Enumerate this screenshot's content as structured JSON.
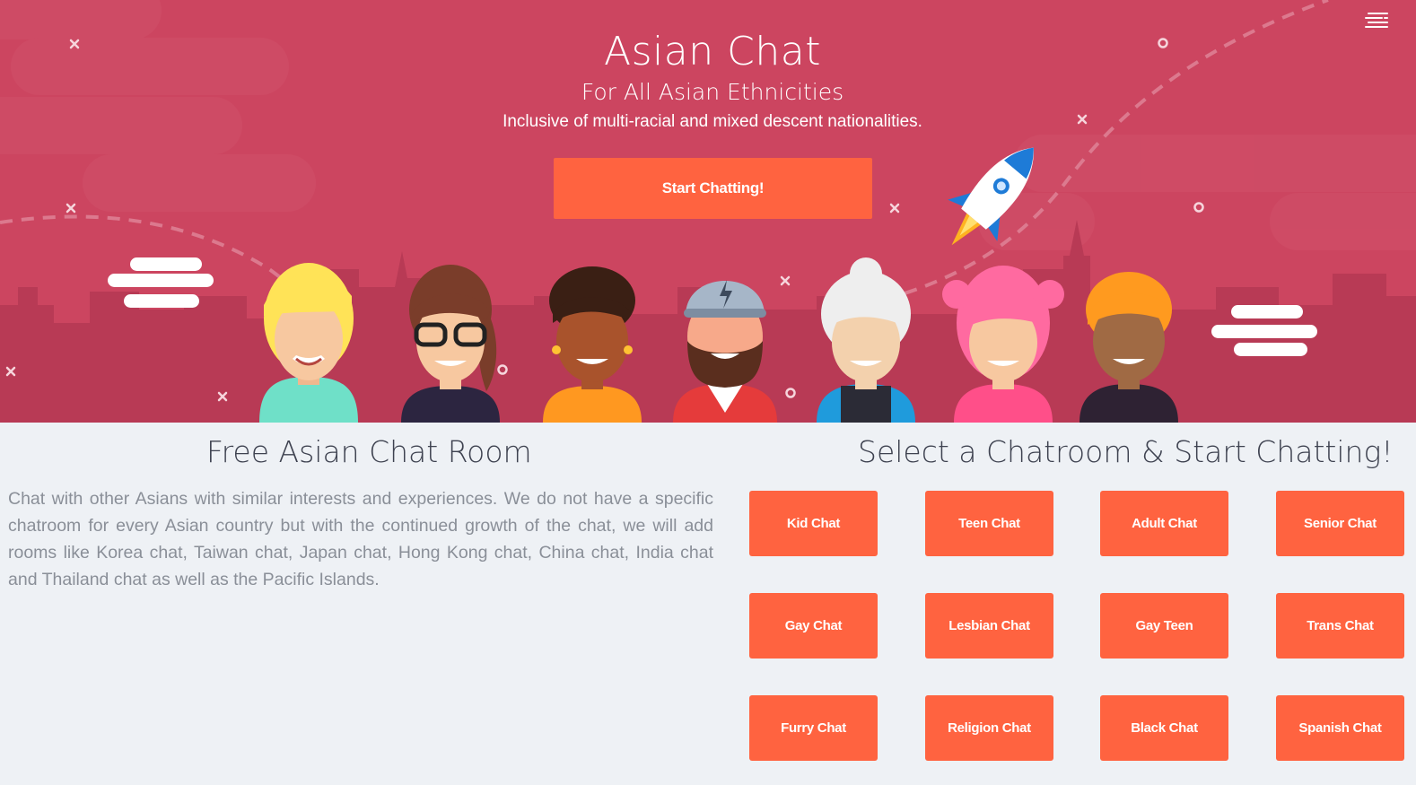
{
  "hero": {
    "title": "Asian Chat",
    "subtitle": "For All Asian Ethnicities",
    "tagline": "Inclusive of multi-racial and mixed descent nationalities.",
    "cta_label": "Start Chatting!",
    "background_color": "#cc4560",
    "accent_color": "#ff6340"
  },
  "nav": {
    "menu_icon": "menu-icon"
  },
  "intro": {
    "title": "Free Asian Chat Room",
    "text": "Chat with other Asians with similar interests and experiences. We do not have a specific chatroom for every Asian country but with the continued growth of the chat, we will add rooms like Korea chat, Taiwan chat, Japan chat, Hong Kong chat, China chat, India chat and Thailand chat as well as the Pacific Islands."
  },
  "rooms": {
    "title": "Select a Chatroom & Start Chatting!",
    "items": [
      {
        "label": "Kid Chat"
      },
      {
        "label": "Teen Chat"
      },
      {
        "label": "Adult Chat"
      },
      {
        "label": "Senior Chat"
      },
      {
        "label": "Gay Chat"
      },
      {
        "label": "Lesbian Chat"
      },
      {
        "label": "Gay Teen"
      },
      {
        "label": "Trans Chat"
      },
      {
        "label": "Furry Chat"
      },
      {
        "label": "Religion Chat"
      },
      {
        "label": "Black Chat"
      },
      {
        "label": "Spanish Chat"
      }
    ]
  }
}
